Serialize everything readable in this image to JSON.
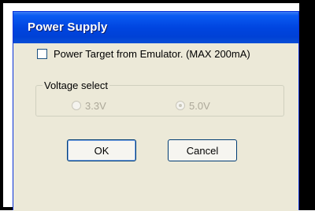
{
  "window": {
    "title": "Power Supply"
  },
  "options": {
    "power_target_label": "Power Target from Emulator. (MAX 200mA)",
    "power_target_checked": false
  },
  "voltage": {
    "group_label": "Voltage select",
    "option_33": "3.3V",
    "option_50": "5.0V",
    "selected": "5.0V",
    "enabled": false
  },
  "buttons": {
    "ok_label": "OK",
    "cancel_label": "Cancel"
  },
  "colors": {
    "titlebar": "#0045e0",
    "dialog_bg": "#ece9d8",
    "disabled_text": "#aca899"
  }
}
